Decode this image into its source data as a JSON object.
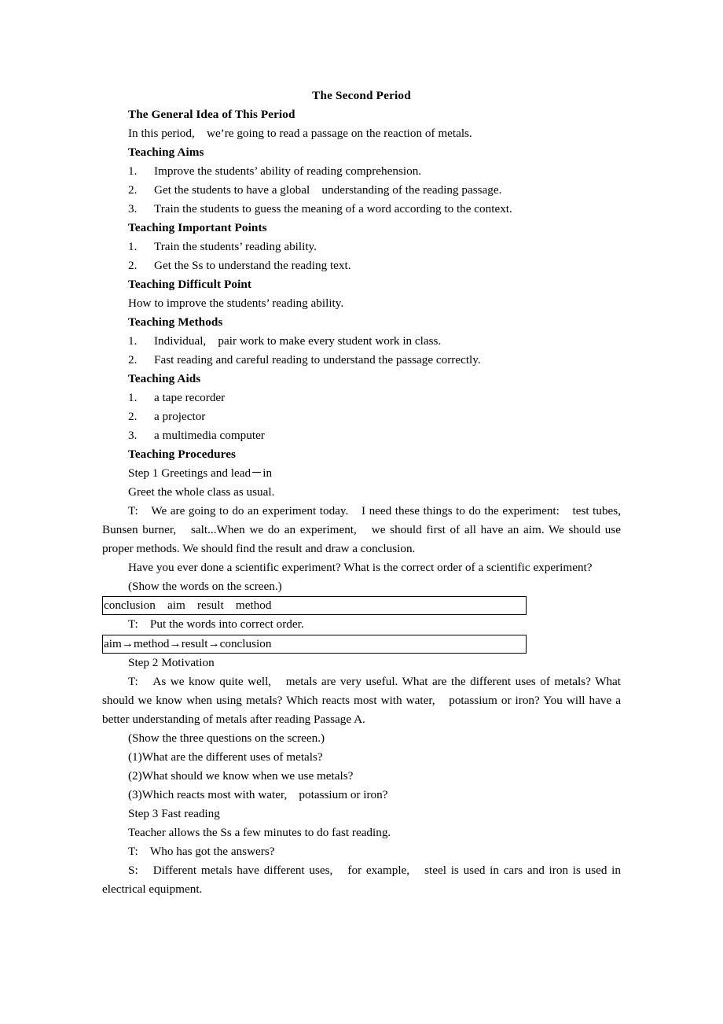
{
  "document": {
    "title": "The Second Period",
    "sections": {
      "general_idea": {
        "heading": "The General Idea of This Period",
        "body": "In this period,　we’re going to read a passage on the reaction of metals."
      },
      "teaching_aims": {
        "heading": "Teaching Aims",
        "items": [
          {
            "num": "1.",
            "text": "Improve the students’ ability of reading comprehension."
          },
          {
            "num": "2.",
            "text": "Get the students to have a global　understanding of the reading passage."
          },
          {
            "num": "3.",
            "text": "Train the students to guess the meaning of a word according to the context."
          }
        ]
      },
      "teaching_important_points": {
        "heading": "Teaching Important Points",
        "items": [
          {
            "num": "1.",
            "text": "Train the students’ reading ability."
          },
          {
            "num": "2.",
            "text": "Get the Ss to understand the reading text."
          }
        ]
      },
      "teaching_difficult_point": {
        "heading": "Teaching Difficult Point",
        "body": "How to improve the students’ reading ability."
      },
      "teaching_methods": {
        "heading": "Teaching Methods",
        "items": [
          {
            "num": "1.",
            "text": "Individual,　pair work to make every student work in class."
          },
          {
            "num": "2.",
            "text": "Fast reading and careful reading to understand the passage correctly."
          }
        ]
      },
      "teaching_aids": {
        "heading": "Teaching Aids",
        "items": [
          {
            "num": "1.",
            "text": "a tape recorder"
          },
          {
            "num": "2.",
            "text": "a projector"
          },
          {
            "num": "3.",
            "text": "a multimedia computer"
          }
        ]
      },
      "teaching_procedures": {
        "heading": "Teaching Procedures",
        "step1": {
          "title": "Step 1 Greetings and lead－in",
          "greet": "Greet the whole class as usual.",
          "teacher_line_1": "T:　We are going to do an experiment today.　I need these things to do the experiment:　test tubes,　Bunsen burner,　salt...When we do an experiment,　we should first of all have an aim. We should use proper methods. We should find the result and draw a conclusion.",
          "teacher_line_2": "Have you ever done a scientific experiment? What is the correct order of a scientific experiment?",
          "show_words_cue": "(Show the words on the screen.)",
          "words_box": "conclusion　aim　result　method",
          "teacher_line_3": "T:　Put the words into correct order.",
          "answer_box": "aim→method→result→conclusion"
        },
        "step2": {
          "title": "Step 2 Motivation",
          "teacher_line": "T:　As we know quite well,　metals are very useful. What are the different uses of metals? What should we know when using metals? Which reacts most with water,　potassium or iron? You will have a better understanding of metals after reading Passage A.",
          "show_questions_cue": "(Show the three questions on the screen.)",
          "questions": [
            "(1)What are the different uses of metals?",
            "(2)What should we know when we use metals?",
            "(3)Which reacts most with water,　potassium or iron?"
          ]
        },
        "step3": {
          "title": "Step 3 Fast reading",
          "teacher_allows": "Teacher allows the Ss a few minutes to do fast reading.",
          "teacher_question": "T:　Who has got the answers?",
          "student_answer": "S:　Different metals have different uses,　for example,　steel is used in cars and iron is used in electrical equipment."
        }
      }
    }
  }
}
